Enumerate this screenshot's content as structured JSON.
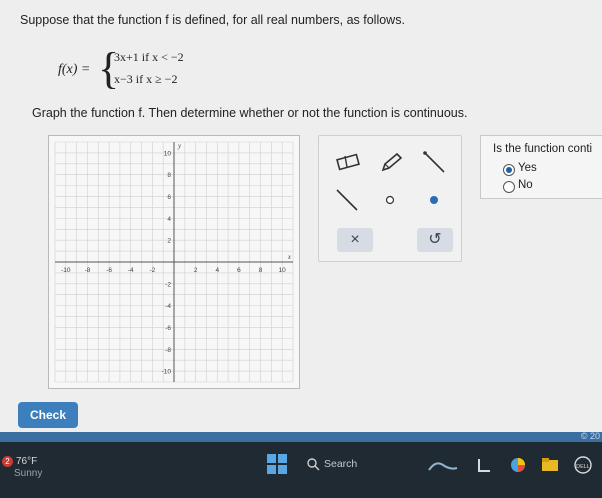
{
  "question": {
    "prompt": "Suppose that the function f is defined, for all real numbers, as follows.",
    "function_name": "f(x) =",
    "piece1": "3x+1  if x < −2",
    "piece2": "x−3   if x ≥ −2",
    "instruction": "Graph the function f. Then determine whether or not the function is continuous."
  },
  "graph": {
    "x_axis_label": "x",
    "y_axis_label": "y",
    "x_ticks": [
      "-10",
      "-8",
      "-6",
      "-4",
      "-2",
      "2",
      "4",
      "6",
      "8",
      "10"
    ],
    "y_ticks": [
      "10",
      "8",
      "6",
      "4",
      "2",
      "-2",
      "-4",
      "-6",
      "-8",
      "-10"
    ],
    "range": [
      -11,
      11
    ]
  },
  "tools": {
    "clear_label": "×",
    "undo_label": "↺",
    "icons": [
      "eraser-icon",
      "pencil-icon",
      "ray-icon",
      "segment-icon",
      "open-circle-icon",
      "closed-dot-icon"
    ]
  },
  "continuity": {
    "question": "Is the function conti",
    "options": [
      {
        "label": "Yes",
        "selected": true
      },
      {
        "label": "No",
        "selected": false
      }
    ]
  },
  "check_label": "Check",
  "copyright": "© 20",
  "taskbar": {
    "badge": "2",
    "temperature": "76°F",
    "condition": "Sunny",
    "search_label": "Search"
  },
  "colors": {
    "check_button": "#3c7fbc",
    "radio_selected": "#1f5fa8",
    "taskbar": "#1f2a33"
  }
}
